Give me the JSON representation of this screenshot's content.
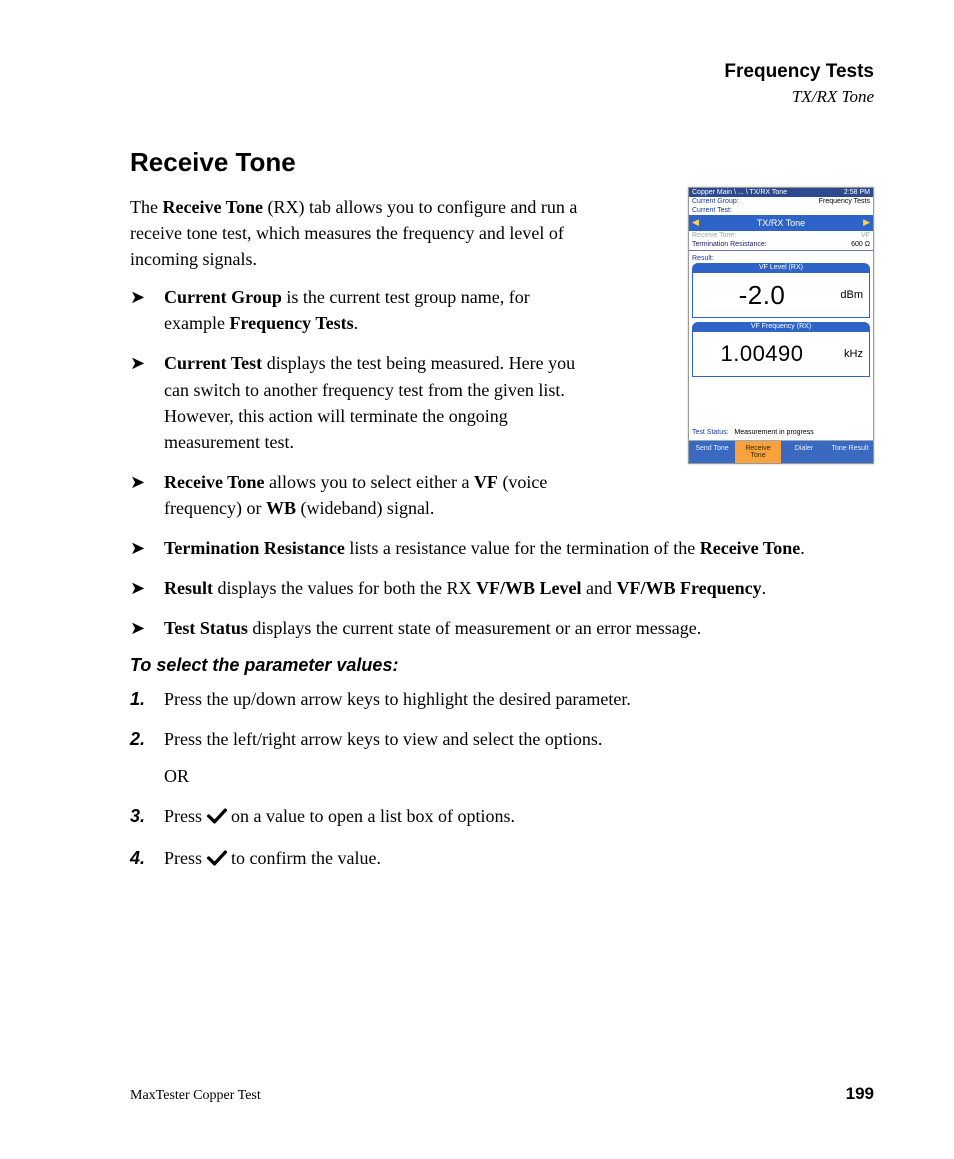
{
  "header": {
    "chapter": "Frequency Tests",
    "section": "TX/RX Tone"
  },
  "title": "Receive Tone",
  "intro_parts": {
    "a": "The ",
    "b": "Receive Tone",
    "c": " (RX) tab allows you to configure and run a receive tone test, which measures the frequency and level of incoming signals."
  },
  "bullets": {
    "b1": {
      "p1": "Current Group",
      "p2": " is the current test group name, for example ",
      "p3": "Frequency Tests",
      "p4": "."
    },
    "b2": {
      "p1": "Current Test",
      "p2": " displays the test being measured. Here you can switch to another frequency test from the given list. However, this action will terminate the ongoing measurement test."
    },
    "b3": {
      "p1": "Receive Tone",
      "p2": " allows you to select either a ",
      "p3": "VF",
      "p4": " (voice frequency) or ",
      "p5": "WB",
      "p6": " (wideband) signal."
    },
    "b4": {
      "p1": "Termination Resistance",
      "p2": " lists a resistance value for the termination of the ",
      "p3": "Receive Tone",
      "p4": "."
    },
    "b5": {
      "p1": "Result",
      "p2": " displays the values for both the RX ",
      "p3": "VF/WB Level",
      "p4": " and ",
      "p5": "VF/WB Frequency",
      "p6": "."
    },
    "b6": {
      "p1": "Test Status",
      "p2": " displays the current state of measurement or an error message."
    }
  },
  "instruction_heading": "To select the parameter values:",
  "steps": {
    "s1": "Press the up/down arrow keys to highlight the desired parameter.",
    "s2": "Press the left/right arrow keys to view and select the options.",
    "or": "OR",
    "s3a": "Press ",
    "s3b": " on a value to open a list box of options.",
    "s4a": "Press ",
    "s4b": " to confirm the value."
  },
  "footer": {
    "product": "MaxTester Copper Test",
    "page": "199"
  },
  "device": {
    "breadcrumb": "Copper Main \\ ... \\ TX/RX Tone",
    "time": "2:58 PM",
    "group_label": "Current Group:",
    "group_value": "Frequency Tests",
    "test_label": "Current Test:",
    "title": "TX/RX Tone",
    "recv_label": "Receive Tone:",
    "recv_value": "VF",
    "term_label": "Termination Resistance:",
    "term_value": "600  Ω",
    "result_label": "Result:",
    "level_head": "VF Level (RX)",
    "level_value": "-2.0",
    "level_unit": "dBm",
    "freq_head": "VF Frequency (RX)",
    "freq_value": "1.00490",
    "freq_unit": "kHz",
    "status_label": "Test Status:",
    "status_value": "Measurement in progress",
    "tabs": {
      "t1": "Send Tone",
      "t2": "Receive Tone",
      "t3": "Dialer",
      "t4": "Tone Result"
    }
  }
}
